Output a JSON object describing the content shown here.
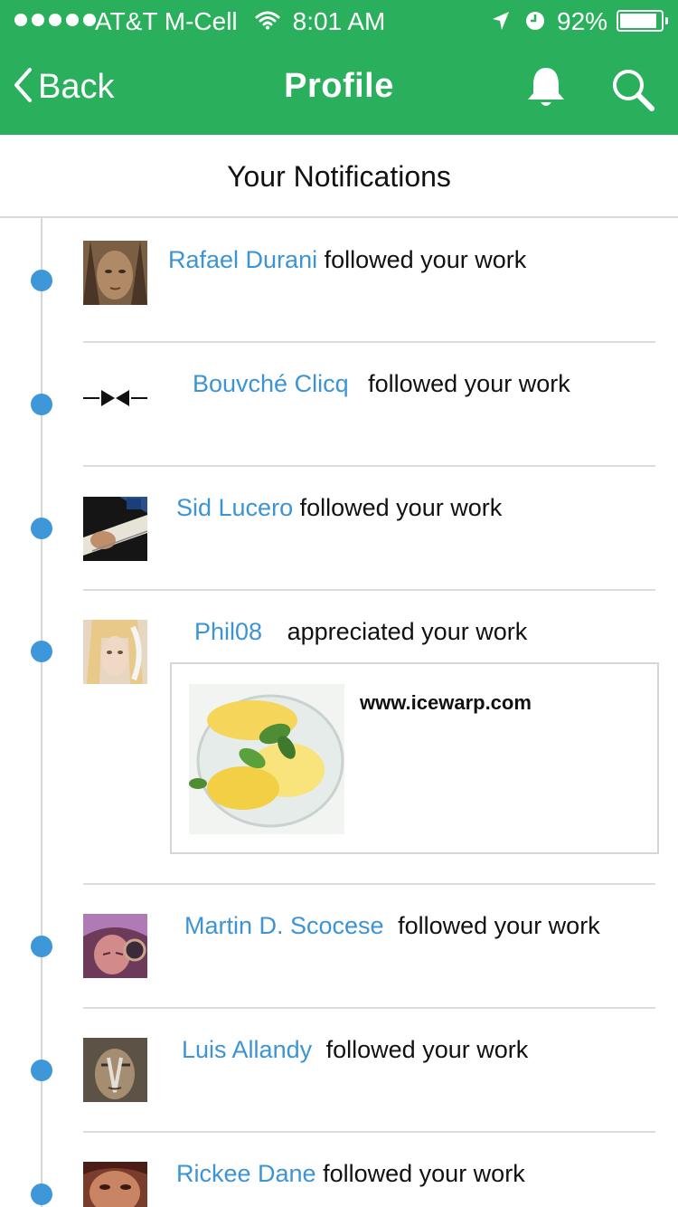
{
  "status_bar": {
    "carrier": "AT&T M-Cell",
    "time": "8:01 AM",
    "battery": "92%",
    "battery_level": 0.92
  },
  "nav": {
    "back_label": "Back",
    "title": "Profile"
  },
  "section_title": "Your Notifications",
  "notifications": [
    {
      "name": "Rafael Durani",
      "action": "followed your work"
    },
    {
      "name": "Bouvché Clicq",
      "action": "followed your work"
    },
    {
      "name": "Sid Lucero",
      "action": "followed your work"
    },
    {
      "name": "Phil08",
      "action": "appreciated your work",
      "card_url": "www.icewarp.com"
    },
    {
      "name": "Martin D. Scocese",
      "action": "followed your work"
    },
    {
      "name": "Luis Allandy",
      "action": "followed your work"
    },
    {
      "name": "Rickee Dane",
      "action": "followed your work"
    }
  ],
  "colors": {
    "brand_green": "#2aaf5c",
    "link_blue": "#3c94d4",
    "timeline_dot": "#3d97d8"
  }
}
